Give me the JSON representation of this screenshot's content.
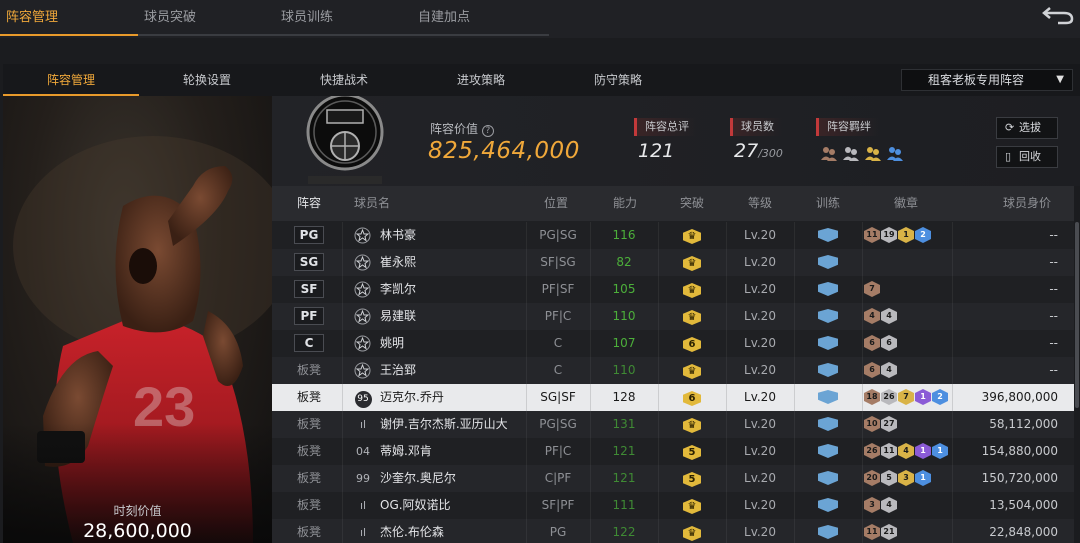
{
  "top_tabs": [
    "阵容管理",
    "球员突破",
    "球员训练",
    "自建加点"
  ],
  "sub_tabs": [
    "阵容管理",
    "轮换设置",
    "快捷战术",
    "进攻策略",
    "防守策略"
  ],
  "dropdown": {
    "value": "租客老板专用阵容"
  },
  "player_panel": {
    "moment_label": "时刻价值",
    "moment_value": "28,600,000"
  },
  "summary": {
    "value_label": "阵容价值",
    "value": "825,464,000",
    "overall_label": "阵容总评",
    "overall": "121",
    "count_label": "球员数",
    "count": "27",
    "count_max": "/300",
    "bond_label": "阵容羁绊",
    "btn_select": "选拔",
    "btn_recycle": "回收"
  },
  "table": {
    "headers": [
      "阵容",
      "球员名",
      "位置",
      "能力",
      "突破",
      "等级",
      "训练",
      "徽章",
      "球员身价"
    ],
    "rows": [
      {
        "slot": "PG",
        "name": "林书豪",
        "pos": "PG|SG",
        "ovr": "116",
        "brk": "",
        "lv": "Lv.20",
        "emblems": [
          [
            "bronze",
            "11"
          ],
          [
            "silver",
            "19"
          ],
          [
            "gold",
            "1"
          ],
          [
            "blue",
            "2"
          ]
        ],
        "worth": "--"
      },
      {
        "slot": "SG",
        "name": "崔永熙",
        "pos": "SF|SG",
        "ovr": "82",
        "brk": "",
        "lv": "Lv.20",
        "emblems": [],
        "worth": "--"
      },
      {
        "slot": "SF",
        "name": "李凯尔",
        "pos": "PF|SF",
        "ovr": "105",
        "brk": "",
        "lv": "Lv.20",
        "emblems": [
          [
            "bronze",
            "7"
          ]
        ],
        "worth": "--"
      },
      {
        "slot": "PF",
        "name": "易建联",
        "pos": "PF|C",
        "ovr": "110",
        "brk": "",
        "lv": "Lv.20",
        "emblems": [
          [
            "bronze",
            "4"
          ],
          [
            "silver",
            "4"
          ]
        ],
        "worth": "--"
      },
      {
        "slot": "C",
        "name": "姚明",
        "pos": "C",
        "ovr": "107",
        "brk": "6",
        "lv": "Lv.20",
        "emblems": [
          [
            "bronze",
            "6"
          ],
          [
            "silver",
            "6"
          ]
        ],
        "worth": "--"
      },
      {
        "slot": "板凳",
        "name": "王治郅",
        "pos": "C",
        "ovr": "110",
        "brk": "",
        "lv": "Lv.20",
        "emblems": [
          [
            "bronze",
            "6"
          ],
          [
            "silver",
            "4"
          ]
        ],
        "worth": "--"
      },
      {
        "slot": "板凳",
        "name": "迈克尔.乔丹",
        "num": "95",
        "pos": "SG|SF",
        "ovr": "128",
        "brk": "6",
        "lv": "Lv.20",
        "emblems": [
          [
            "bronze",
            "18"
          ],
          [
            "silver",
            "26"
          ],
          [
            "gold",
            "7"
          ],
          [
            "purple",
            "1"
          ],
          [
            "blue",
            "2"
          ]
        ],
        "worth": "396,800,000"
      },
      {
        "slot": "板凳",
        "name": "谢伊.吉尔杰斯.亚历山大",
        "num": "ıl",
        "pos": "PG|SG",
        "ovr": "131",
        "brk": "",
        "lv": "Lv.20",
        "emblems": [
          [
            "bronze",
            "10"
          ],
          [
            "silver",
            "27"
          ]
        ],
        "worth": "58,112,000"
      },
      {
        "slot": "板凳",
        "name": "蒂姆.邓肯",
        "num": "04",
        "pos": "PF|C",
        "ovr": "121",
        "brk": "5",
        "lv": "Lv.20",
        "emblems": [
          [
            "bronze",
            "26"
          ],
          [
            "silver",
            "11"
          ],
          [
            "gold",
            "4"
          ],
          [
            "purple",
            "1"
          ],
          [
            "blue",
            "1"
          ]
        ],
        "worth": "154,880,000"
      },
      {
        "slot": "板凳",
        "name": "沙奎尔.奥尼尔",
        "num": "99",
        "pos": "C|PF",
        "ovr": "121",
        "brk": "5",
        "lv": "Lv.20",
        "emblems": [
          [
            "bronze",
            "20"
          ],
          [
            "silver",
            "5"
          ],
          [
            "gold",
            "3"
          ],
          [
            "blue",
            "1"
          ]
        ],
        "worth": "150,720,000"
      },
      {
        "slot": "板凳",
        "name": "OG.阿奴诺比",
        "num": "ıl",
        "pos": "SF|PF",
        "ovr": "111",
        "brk": "",
        "lv": "Lv.20",
        "emblems": [
          [
            "bronze",
            "3"
          ],
          [
            "silver",
            "4"
          ]
        ],
        "worth": "13,504,000"
      },
      {
        "slot": "板凳",
        "name": "杰伦.布伦森",
        "num": "ıl",
        "pos": "PG",
        "ovr": "122",
        "brk": "",
        "lv": "Lv.20",
        "emblems": [
          [
            "bronze",
            "11"
          ],
          [
            "silver",
            "21"
          ]
        ],
        "worth": "22,848,000"
      }
    ]
  },
  "colors": {
    "accent": "#f0a83a",
    "overall_green": "#4caf3a",
    "break_badge": "#e2b93b",
    "train_icon": "#6ba4d4"
  },
  "icons": {
    "back": "back-arrow-icon",
    "caret": "caret-down-icon",
    "help": "help-circle-icon",
    "star": "star-icon",
    "bond": "bond-people-icon"
  }
}
